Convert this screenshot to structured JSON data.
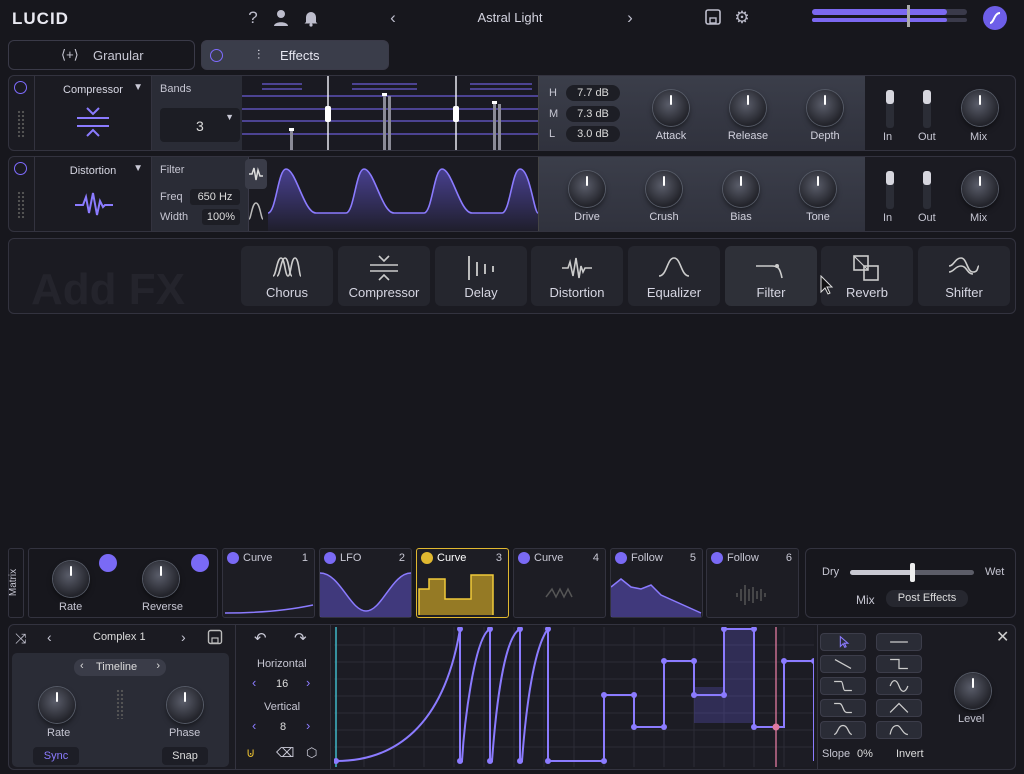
{
  "app": {
    "logo": "LUCID",
    "preset": "Astral Light",
    "help": "?"
  },
  "tabs": [
    {
      "label": "Granular"
    },
    {
      "label": "Effects"
    }
  ],
  "compressor": {
    "name": "Compressor",
    "bands_label": "Bands",
    "bands_value": "3",
    "h_label": "H",
    "h_value": "7.7 dB",
    "m_label": "M",
    "m_value": "7.3 dB",
    "l_label": "L",
    "l_value": "3.0 dB",
    "knobs": [
      "Attack",
      "Release",
      "Depth"
    ],
    "in": "In",
    "out": "Out",
    "mix": "Mix"
  },
  "distortion": {
    "name": "Distortion",
    "filter_label": "Filter",
    "freq_label": "Freq",
    "freq_value": "650 Hz",
    "width_label": "Width",
    "width_value": "100%",
    "knobs": [
      "Drive",
      "Crush",
      "Bias",
      "Tone"
    ],
    "in": "In",
    "out": "Out",
    "mix": "Mix"
  },
  "addfx": {
    "title": "Add FX",
    "items": [
      "Chorus",
      "Compressor",
      "Delay",
      "Distortion",
      "Equalizer",
      "Filter",
      "Reverb",
      "Shifter"
    ]
  },
  "matrix": {
    "label": "Matrix",
    "rate": "Rate",
    "reverse": "Reverse"
  },
  "mods": [
    {
      "name": "Curve",
      "num": "1"
    },
    {
      "name": "LFO",
      "num": "2"
    },
    {
      "name": "Curve",
      "num": "3"
    },
    {
      "name": "Curve",
      "num": "4"
    },
    {
      "name": "Follow",
      "num": "5"
    },
    {
      "name": "Follow",
      "num": "6"
    }
  ],
  "mixer": {
    "dry": "Dry",
    "wet": "Wet",
    "mix": "Mix",
    "post": "Post Effects",
    "level": 0.5
  },
  "curve": {
    "preset": "Complex 1",
    "timeline": "Timeline",
    "rate": "Rate",
    "phase": "Phase",
    "sync": "Sync",
    "snap": "Snap",
    "horizontal": "Horizontal",
    "h_value": "16",
    "vertical": "Vertical",
    "v_value": "8",
    "slope": "Slope",
    "slope_value": "0%",
    "invert": "Invert",
    "level": "Level"
  }
}
